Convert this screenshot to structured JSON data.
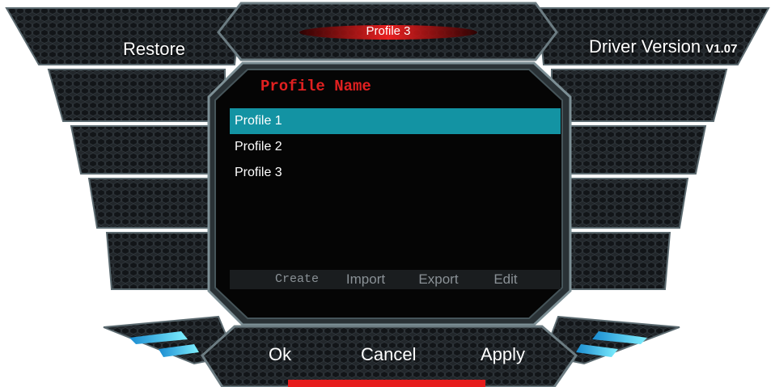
{
  "header": {
    "profile_tab_label": "Profile 3"
  },
  "left_wing": {
    "restore_label": "Restore"
  },
  "right_wing": {
    "driver_version_label": "Driver Version",
    "version": "V1.07"
  },
  "profile_panel": {
    "title": "Profile Name",
    "profiles": [
      "Profile 1",
      "Profile 2",
      "Profile 3"
    ],
    "selected_index": 0,
    "toolbar": {
      "create": "Create",
      "import": "Import",
      "export": "Export",
      "edit": "Edit"
    }
  },
  "footer": {
    "ok": "Ok",
    "cancel": "Cancel",
    "apply": "Apply"
  },
  "colors": {
    "accent_cyan": "#1393a3",
    "title_red": "#e02020",
    "frame": "#3c4a50",
    "accent_blue": "#4fd8ff"
  }
}
